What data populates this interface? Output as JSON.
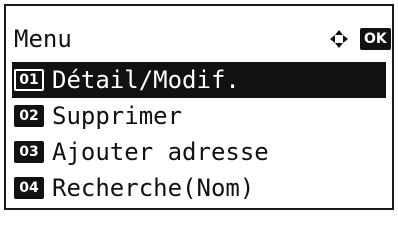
{
  "header": {
    "title": "Menu",
    "nav_icon": "four-way-arrow-icon",
    "ok_label": "OK"
  },
  "menu": {
    "items": [
      {
        "num": "01",
        "label": "Détail/Modif.",
        "selected": true
      },
      {
        "num": "02",
        "label": "Supprimer",
        "selected": false
      },
      {
        "num": "03",
        "label": "Ajouter adresse",
        "selected": false
      },
      {
        "num": "04",
        "label": "Recherche(Nom)",
        "selected": false
      }
    ]
  },
  "colors": {
    "foreground": "#111111",
    "background": "#ffffff"
  }
}
